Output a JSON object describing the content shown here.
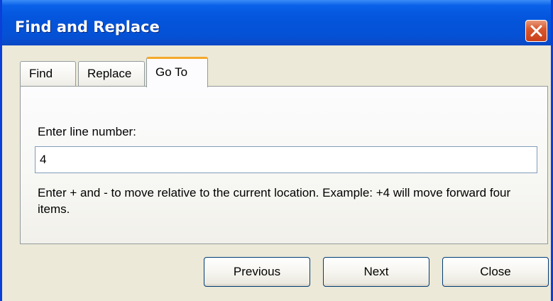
{
  "window": {
    "title": "Find and Replace"
  },
  "tabs": [
    {
      "label": "Find"
    },
    {
      "label": "Replace"
    },
    {
      "label": "Go To"
    }
  ],
  "goto": {
    "label": "Enter line number:",
    "value": "4",
    "hint": "Enter + and - to move relative to the current location. Example: +4 will move forward four items."
  },
  "buttons": {
    "previous": "Previous",
    "next": "Next",
    "close": "Close"
  },
  "colors": {
    "titlebar": "#0453d8",
    "active_tab_accent": "#f4a82a",
    "close_button": "#d9582e",
    "dialog_background": "#ece9d8"
  },
  "icons": {
    "close": "close-x-icon"
  }
}
